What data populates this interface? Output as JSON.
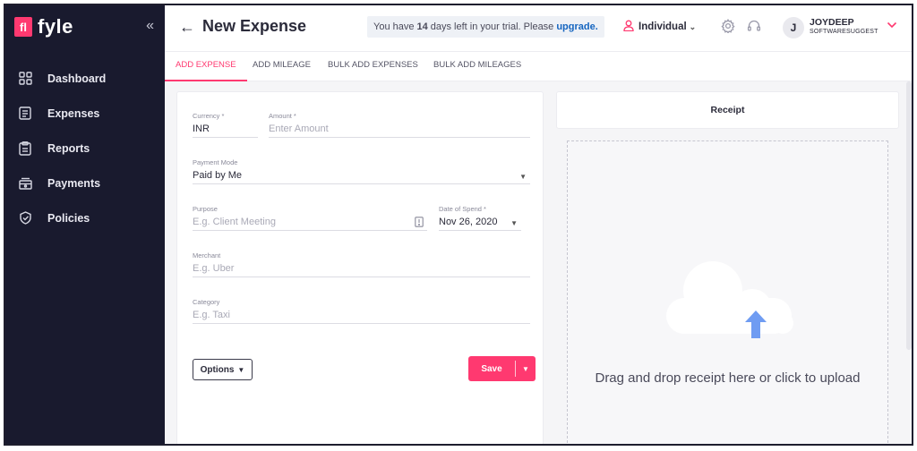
{
  "brand": {
    "logo_mark": "fl",
    "name": "fyle",
    "collapse_label": "«"
  },
  "sidebar": {
    "items": [
      {
        "label": "Dashboard",
        "icon": "dashboard-icon"
      },
      {
        "label": "Expenses",
        "icon": "expenses-icon"
      },
      {
        "label": "Reports",
        "icon": "reports-icon"
      },
      {
        "label": "Payments",
        "icon": "payments-icon"
      },
      {
        "label": "Policies",
        "icon": "policies-icon"
      }
    ]
  },
  "header": {
    "back": "←",
    "title": "New Expense",
    "trial_prefix": "You have",
    "trial_days": "14",
    "trial_suffix": "days left in your trial. Please",
    "trial_link": "upgrade.",
    "mode": "Individual",
    "user_initial": "J",
    "user_name": "JOYDEEP",
    "user_org": "SOFTWARESUGGEST"
  },
  "tabs": [
    {
      "label": "ADD EXPENSE",
      "active": true
    },
    {
      "label": "ADD MILEAGE",
      "active": false
    },
    {
      "label": "BULK ADD EXPENSES",
      "active": false
    },
    {
      "label": "BULK ADD MILEAGES",
      "active": false
    }
  ],
  "form": {
    "currency_label": "Currency *",
    "currency_value": "INR",
    "amount_label": "Amount *",
    "amount_placeholder": "Enter Amount",
    "payment_mode_label": "Payment Mode",
    "payment_mode_value": "Paid by Me",
    "purpose_label": "Purpose",
    "purpose_placeholder": "E.g. Client Meeting",
    "date_label": "Date of Spend *",
    "date_value": "Nov 26, 2020",
    "merchant_label": "Merchant",
    "merchant_placeholder": "E.g. Uber",
    "category_label": "Category",
    "category_placeholder": "E.g. Taxi",
    "options_label": "Options",
    "save_label": "Save"
  },
  "receipt": {
    "title": "Receipt",
    "drop_text": "Drag and drop receipt here or click to upload"
  },
  "colors": {
    "accent": "#ff3970",
    "sidebar_bg": "#191a2e",
    "link": "#1565c0",
    "upload_arrow": "#6f9cf2"
  }
}
